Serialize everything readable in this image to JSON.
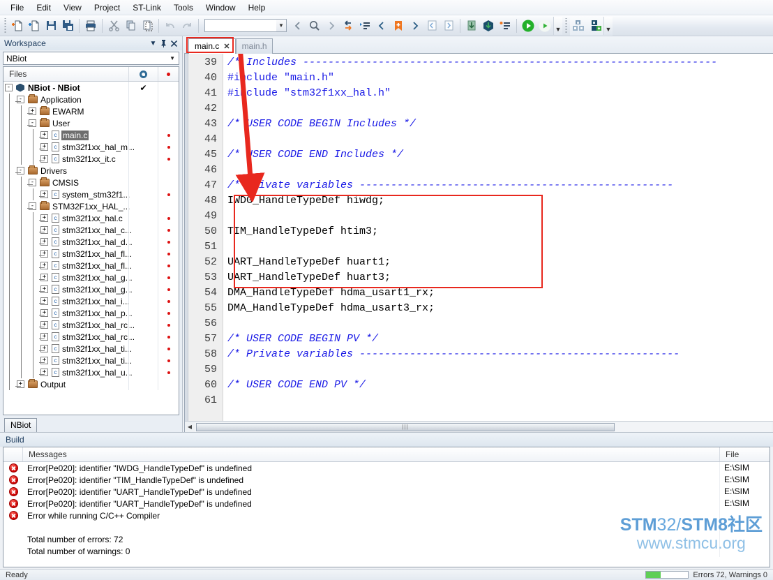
{
  "menu": {
    "items": [
      "File",
      "Edit",
      "View",
      "Project",
      "ST-Link",
      "Tools",
      "Window",
      "Help"
    ]
  },
  "toolbar": {
    "combo_value": "",
    "icons": [
      "new-document-icon",
      "new-workspace-icon",
      "save-icon",
      "save-all-icon",
      "print-icon",
      "cut-icon",
      "copy-icon",
      "paste-icon",
      "undo-icon",
      "redo-icon"
    ],
    "nav_icons": [
      "navigate-back-icon",
      "find-icon",
      "navigate-forward-icon",
      "goto-declaration-icon",
      "bookmark-list-icon",
      "previous-bookmark-icon",
      "toggle-bookmark-icon",
      "next-bookmark-icon",
      "previous-error-icon",
      "next-error-icon",
      "download-icon",
      "download-active-icon",
      "breakpoints-icon",
      "make-icon",
      "run-icon",
      "debug-icon",
      "debug-download-icon"
    ]
  },
  "workspace": {
    "title": "Workspace",
    "header_icons": [
      "chevron-down-icon",
      "pin-icon",
      "close-icon"
    ],
    "project_selector": "NBiot",
    "columns": {
      "files": "Files",
      "settings": "gear-icon",
      "status": "red-dot-icon"
    },
    "tab": "NBiot",
    "tree": [
      {
        "label": "NBiot - NBiot",
        "depth": 0,
        "type": "project",
        "expander": "-",
        "check": true,
        "dot": false,
        "selected": false
      },
      {
        "label": "Application",
        "depth": 1,
        "type": "folder",
        "expander": "-",
        "check": false,
        "dot": false,
        "selected": false
      },
      {
        "label": "EWARM",
        "depth": 2,
        "type": "folder",
        "expander": "+",
        "check": false,
        "dot": false,
        "selected": false
      },
      {
        "label": "User",
        "depth": 2,
        "type": "folder",
        "expander": "-",
        "check": false,
        "dot": false,
        "selected": false
      },
      {
        "label": "main.c",
        "depth": 3,
        "type": "cfile",
        "expander": "+",
        "check": false,
        "dot": true,
        "selected": true
      },
      {
        "label": "stm32f1xx_hal_m...",
        "depth": 3,
        "type": "cfile",
        "expander": "+",
        "check": false,
        "dot": true,
        "selected": false
      },
      {
        "label": "stm32f1xx_it.c",
        "depth": 3,
        "type": "cfile",
        "expander": "+",
        "check": false,
        "dot": true,
        "selected": false
      },
      {
        "label": "Drivers",
        "depth": 1,
        "type": "folder",
        "expander": "-",
        "check": false,
        "dot": false,
        "selected": false
      },
      {
        "label": "CMSIS",
        "depth": 2,
        "type": "folder",
        "expander": "-",
        "check": false,
        "dot": false,
        "selected": false
      },
      {
        "label": "system_stm32f1...",
        "depth": 3,
        "type": "cfile",
        "expander": "+",
        "check": false,
        "dot": true,
        "selected": false
      },
      {
        "label": "STM32F1xx_HAL_...",
        "depth": 2,
        "type": "folder",
        "expander": "-",
        "check": false,
        "dot": false,
        "selected": false
      },
      {
        "label": "stm32f1xx_hal.c",
        "depth": 3,
        "type": "cfile",
        "expander": "+",
        "check": false,
        "dot": true,
        "selected": false
      },
      {
        "label": "stm32f1xx_hal_c...",
        "depth": 3,
        "type": "cfile",
        "expander": "+",
        "check": false,
        "dot": true,
        "selected": false
      },
      {
        "label": "stm32f1xx_hal_d...",
        "depth": 3,
        "type": "cfile",
        "expander": "+",
        "check": false,
        "dot": true,
        "selected": false
      },
      {
        "label": "stm32f1xx_hal_fl...",
        "depth": 3,
        "type": "cfile",
        "expander": "+",
        "check": false,
        "dot": true,
        "selected": false
      },
      {
        "label": "stm32f1xx_hal_fl...",
        "depth": 3,
        "type": "cfile",
        "expander": "+",
        "check": false,
        "dot": true,
        "selected": false
      },
      {
        "label": "stm32f1xx_hal_g...",
        "depth": 3,
        "type": "cfile",
        "expander": "+",
        "check": false,
        "dot": true,
        "selected": false
      },
      {
        "label": "stm32f1xx_hal_g...",
        "depth": 3,
        "type": "cfile",
        "expander": "+",
        "check": false,
        "dot": true,
        "selected": false
      },
      {
        "label": "stm32f1xx_hal_i...",
        "depth": 3,
        "type": "cfile",
        "expander": "+",
        "check": false,
        "dot": true,
        "selected": false
      },
      {
        "label": "stm32f1xx_hal_p...",
        "depth": 3,
        "type": "cfile",
        "expander": "+",
        "check": false,
        "dot": true,
        "selected": false
      },
      {
        "label": "stm32f1xx_hal_rc...",
        "depth": 3,
        "type": "cfile",
        "expander": "+",
        "check": false,
        "dot": true,
        "selected": false
      },
      {
        "label": "stm32f1xx_hal_rc...",
        "depth": 3,
        "type": "cfile",
        "expander": "+",
        "check": false,
        "dot": true,
        "selected": false
      },
      {
        "label": "stm32f1xx_hal_ti...",
        "depth": 3,
        "type": "cfile",
        "expander": "+",
        "check": false,
        "dot": true,
        "selected": false
      },
      {
        "label": "stm32f1xx_hal_ti...",
        "depth": 3,
        "type": "cfile",
        "expander": "+",
        "check": false,
        "dot": true,
        "selected": false
      },
      {
        "label": "stm32f1xx_hal_u...",
        "depth": 3,
        "type": "cfile",
        "expander": "+",
        "check": false,
        "dot": true,
        "selected": false
      },
      {
        "label": "Output",
        "depth": 1,
        "type": "folder",
        "expander": "+",
        "check": false,
        "dot": false,
        "selected": false
      }
    ]
  },
  "editor": {
    "tabs": [
      {
        "label": "main.c",
        "active": true,
        "closable": true,
        "highlighted": true
      },
      {
        "label": "main.h",
        "active": false,
        "closable": false,
        "highlighted": false
      }
    ],
    "first_line_number": 39,
    "lines": [
      {
        "n": 39,
        "segments": [
          {
            "t": "/* Includes ------------------------------------------------------------------",
            "c": "cmt"
          }
        ]
      },
      {
        "n": 40,
        "segments": [
          {
            "t": "#include ",
            "c": "pre"
          },
          {
            "t": "\"main.h\"",
            "c": "str"
          }
        ]
      },
      {
        "n": 41,
        "segments": [
          {
            "t": "#include ",
            "c": "pre"
          },
          {
            "t": "\"stm32f1xx_hal.h\"",
            "c": "str"
          }
        ]
      },
      {
        "n": 42,
        "segments": []
      },
      {
        "n": 43,
        "segments": [
          {
            "t": "/* USER CODE BEGIN Includes */",
            "c": "cmt"
          }
        ]
      },
      {
        "n": 44,
        "segments": []
      },
      {
        "n": 45,
        "segments": [
          {
            "t": "/* USER CODE END Includes */",
            "c": "cmt"
          }
        ]
      },
      {
        "n": 46,
        "segments": []
      },
      {
        "n": 47,
        "segments": [
          {
            "t": "/* Private variables --------------------------------------------------",
            "c": "cmt"
          }
        ]
      },
      {
        "n": 48,
        "segments": [
          {
            "t": "IWDG_HandleTypeDef hiwdg;",
            "c": "plain"
          }
        ]
      },
      {
        "n": 49,
        "segments": []
      },
      {
        "n": 50,
        "segments": [
          {
            "t": "TIM_HandleTypeDef htim3;",
            "c": "plain"
          }
        ]
      },
      {
        "n": 51,
        "segments": []
      },
      {
        "n": 52,
        "segments": [
          {
            "t": "UART_HandleTypeDef huart1;",
            "c": "plain"
          }
        ]
      },
      {
        "n": 53,
        "segments": [
          {
            "t": "UART_HandleTypeDef huart3;",
            "c": "plain"
          }
        ]
      },
      {
        "n": 54,
        "segments": [
          {
            "t": "DMA_HandleTypeDef hdma_usart1_rx;",
            "c": "plain"
          }
        ]
      },
      {
        "n": 55,
        "segments": [
          {
            "t": "DMA_HandleTypeDef hdma_usart3_rx;",
            "c": "plain"
          }
        ]
      },
      {
        "n": 56,
        "segments": []
      },
      {
        "n": 57,
        "segments": [
          {
            "t": "/* USER CODE BEGIN PV */",
            "c": "cmt"
          }
        ]
      },
      {
        "n": 58,
        "segments": [
          {
            "t": "/* Private variables ---------------------------------------------------",
            "c": "cmt"
          }
        ]
      },
      {
        "n": 59,
        "segments": []
      },
      {
        "n": 60,
        "segments": [
          {
            "t": "/* USER CODE END PV */",
            "c": "cmt"
          }
        ]
      },
      {
        "n": 61,
        "segments": []
      }
    ],
    "annotation_color": "#e8281e"
  },
  "build": {
    "title": "Build",
    "columns": {
      "messages": "Messages",
      "file": "File"
    },
    "rows": [
      {
        "icon": "error-icon",
        "message": "Error[Pe020]: identifier \"IWDG_HandleTypeDef\" is undefined",
        "file": "E:\\SIM"
      },
      {
        "icon": "error-icon",
        "message": "Error[Pe020]: identifier \"TIM_HandleTypeDef\" is undefined",
        "file": "E:\\SIM"
      },
      {
        "icon": "error-icon",
        "message": "Error[Pe020]: identifier \"UART_HandleTypeDef\" is undefined",
        "file": "E:\\SIM"
      },
      {
        "icon": "error-icon",
        "message": "Error[Pe020]: identifier \"UART_HandleTypeDef\" is undefined",
        "file": "E:\\SIM"
      },
      {
        "icon": "error-icon",
        "message": "Error while running C/C++ Compiler",
        "file": ""
      },
      {
        "icon": "",
        "message": "",
        "file": ""
      },
      {
        "icon": "",
        "message": "Total number of errors: 72",
        "file": ""
      },
      {
        "icon": "",
        "message": "Total number of warnings: 0",
        "file": ""
      }
    ]
  },
  "watermark": {
    "line1_a": "STM",
    "line1_b": "32/",
    "line1_c": "STM",
    "line1_d": "8社区",
    "line2": "www.stmcu.org",
    "color": "#5e9ed6"
  },
  "statusbar": {
    "left": "Ready",
    "right": "Errors 72, Warnings 0",
    "progress_percent": 35
  }
}
